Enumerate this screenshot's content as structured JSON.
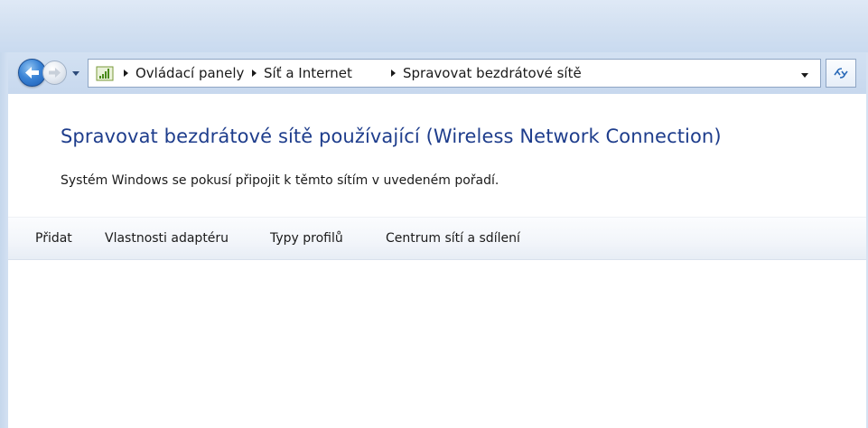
{
  "window": {
    "navigation": {
      "back_icon": "back-arrow-icon",
      "forward_icon": "forward-arrow-icon",
      "recent_icon": "chevron-down-icon"
    },
    "address_bar": {
      "location_icon": "network-signal-icon",
      "breadcrumbs": [
        "Ovládací panely",
        "Síť a Internet",
        "Spravovat bezdrátové sítě"
      ],
      "dropdown_icon": "chevron-down-icon",
      "refresh_icon": "refresh-icon"
    }
  },
  "main": {
    "title": "Spravovat bezdrátové sítě používající (Wireless Network Connection)",
    "description": "Systém Windows se pokusí připojit k těmto sítím v uvedeném pořadí."
  },
  "toolbar": {
    "items": [
      "Přidat",
      "Vlastnosti adaptéru",
      "Typy profilů",
      "Centrum sítí a sdílení"
    ]
  },
  "colors": {
    "title": "#1e3d8c",
    "frame": "#d2e0f1"
  }
}
